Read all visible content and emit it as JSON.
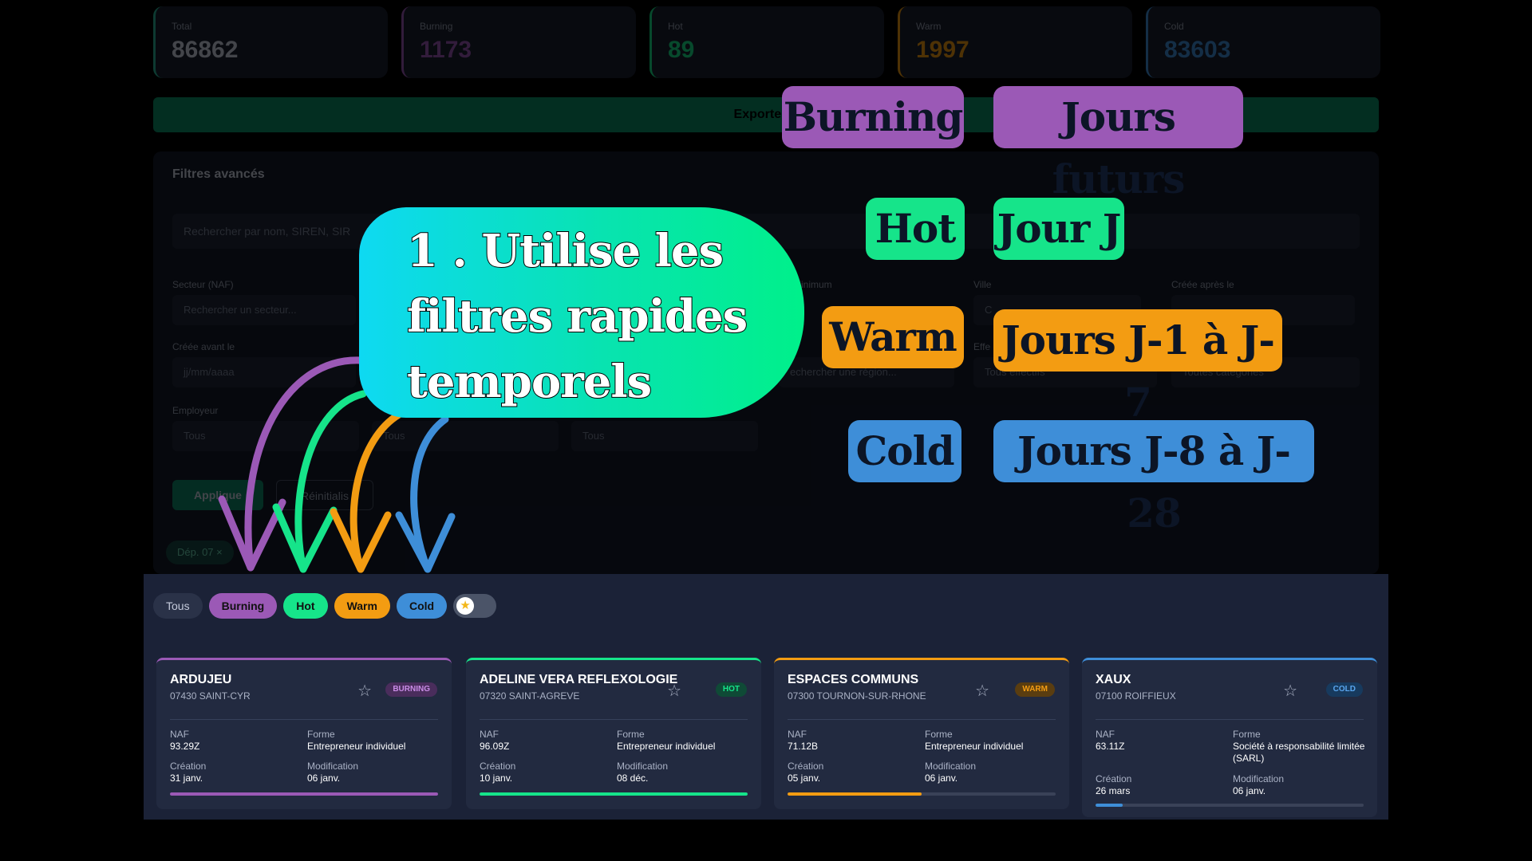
{
  "stats": [
    {
      "label": "Total",
      "value": "86862",
      "color": "#2bb59a"
    },
    {
      "label": "Burning",
      "value": "1173",
      "color": "#9b59b6"
    },
    {
      "label": "Hot",
      "value": "89",
      "color": "#16e48a"
    },
    {
      "label": "Warm",
      "value": "1997",
      "color": "#f39c12"
    },
    {
      "label": "Cold",
      "value": "83603",
      "color": "#3e8ed8"
    }
  ],
  "export_label": "Exporter E",
  "filters": {
    "title": "Filtres avancés",
    "search_placeholder": "Rechercher par nom, SIREN, SIR",
    "secteur_label": "Secteur (NAF)",
    "secteur_placeholder": "Rechercher un secteur...",
    "cree_avant_label": "Créée avant le",
    "cree_avant_value": "jj/mm/aaaa",
    "employeur_label": "Employeur",
    "select_tous_1": "Tous",
    "select_tous_2": "Tous",
    "select_tous_3": "Tous",
    "minimum_label": "inimum",
    "ville_label": "Ville",
    "cree_apres_label": "Créée après le",
    "ville_value": "C",
    "effectif_label": "Effe",
    "region_placeholder": "echercher une région...",
    "effectifs_value": "Tous effectifs",
    "categories_value": "Toutes catégories",
    "apply_label": "Applique",
    "reset_label": "Réinitialis",
    "dep_tag": "Dép. 07 ×"
  },
  "chips": {
    "tous": "Tous",
    "burning": "Burning",
    "hot": "Hot",
    "warm": "Warm",
    "cold": "Cold",
    "favorites_toggle_icon": "star-icon"
  },
  "cards": [
    {
      "name": "ARDUJEU",
      "location": "07430 SAINT-CYR",
      "badge": "BURNING",
      "naf_label": "NAF",
      "naf": "93.29Z",
      "forme_label": "Forme",
      "forme": "Entrepreneur individuel",
      "creation_label": "Création",
      "creation": "31 janv.",
      "modif_label": "Modification",
      "modification": "06 janv.",
      "progress": 1.0,
      "color": "#9b59b6"
    },
    {
      "name": "ADELINE VERA REFLEXOLOGIE",
      "location": "07320 SAINT-AGREVE",
      "badge": "HOT",
      "naf_label": "NAF",
      "naf": "96.09Z",
      "forme_label": "Forme",
      "forme": "Entrepreneur individuel",
      "creation_label": "Création",
      "creation": "10 janv.",
      "modif_label": "Modification",
      "modification": "08 déc.",
      "progress": 1.0,
      "color": "#16e48a"
    },
    {
      "name": "ESPACES COMMUNS",
      "location": "07300 TOURNON-SUR-RHONE",
      "badge": "WARM",
      "naf_label": "NAF",
      "naf": "71.12B",
      "forme_label": "Forme",
      "forme": "Entrepreneur individuel",
      "creation_label": "Création",
      "creation": "05 janv.",
      "modif_label": "Modification",
      "modification": "06 janv.",
      "progress": 0.5,
      "color": "#f39c12"
    },
    {
      "name": "XAUX",
      "location": "07100 ROIFFIEUX",
      "badge": "COLD",
      "naf_label": "NAF",
      "naf": "63.11Z",
      "forme_label": "Forme",
      "forme": "Société à responsabilité limitée (SARL)",
      "creation_label": "Création",
      "creation": "26 mars",
      "modif_label": "Modification",
      "modification": "06 janv.",
      "progress": 0.1,
      "color": "#3e8ed8"
    }
  ],
  "annotation": {
    "callout_line1": "1 . Utilise les",
    "callout_line2": "filtres rapides",
    "callout_line3": "temporels"
  },
  "legend": {
    "burning": "Burning",
    "burning_desc": "Jours futurs",
    "hot": "Hot",
    "hot_desc": "Jour J",
    "warm": "Warm",
    "warm_desc": "Jours J-1 à J-7",
    "cold": "Cold",
    "cold_desc": "Jours J-8 à J-28"
  }
}
